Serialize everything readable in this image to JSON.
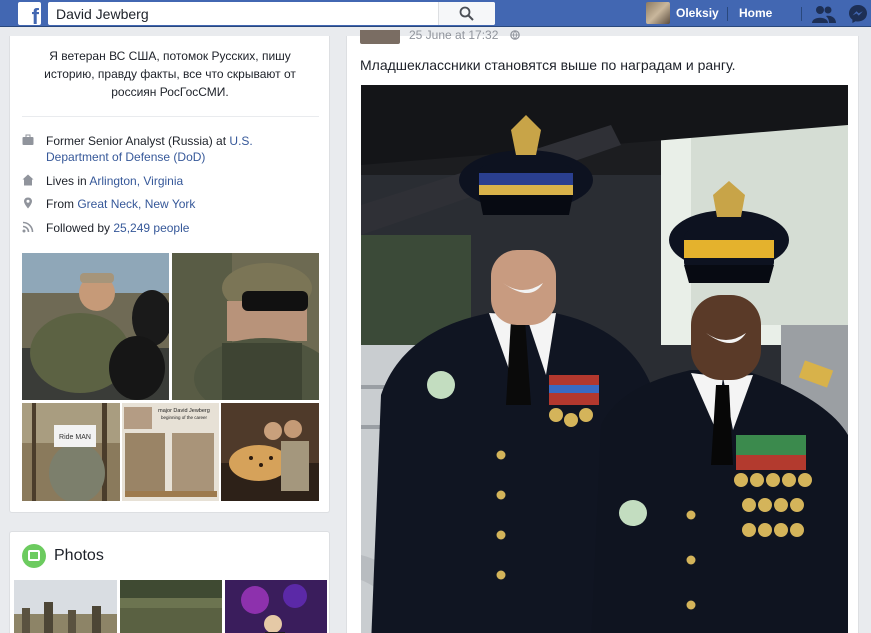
{
  "topbar": {
    "logo": "f",
    "search_value": "David Jewberg",
    "user_name": "Oleksiy",
    "home_label": "Home",
    "brand_color": "#4267b2"
  },
  "intro": {
    "bio": "Я ветеран ВС США, потомок Русских, пишу историю, правду факты, все что скрывают от россиян РосГосСМИ.",
    "work": {
      "prefix": "Former Senior Analyst (Russia) at ",
      "link": "U.S. Department of Defense (DoD)"
    },
    "lives": {
      "prefix": "Lives in ",
      "link": "Arlington, Virginia"
    },
    "from": {
      "prefix": "From ",
      "link": "Great Neck, New York"
    },
    "followers": {
      "prefix": "Followed by ",
      "link": "25,249 people"
    },
    "photo_captions": {
      "sign": "Ride MAN",
      "note_line1": "major David Jewberg",
      "note_line2": "beginning of the career"
    }
  },
  "photos_section": {
    "title": "Photos"
  },
  "post": {
    "date": "25 June at 17:32",
    "text": "Младшеклассники становятся выше по наградам и рангу."
  }
}
